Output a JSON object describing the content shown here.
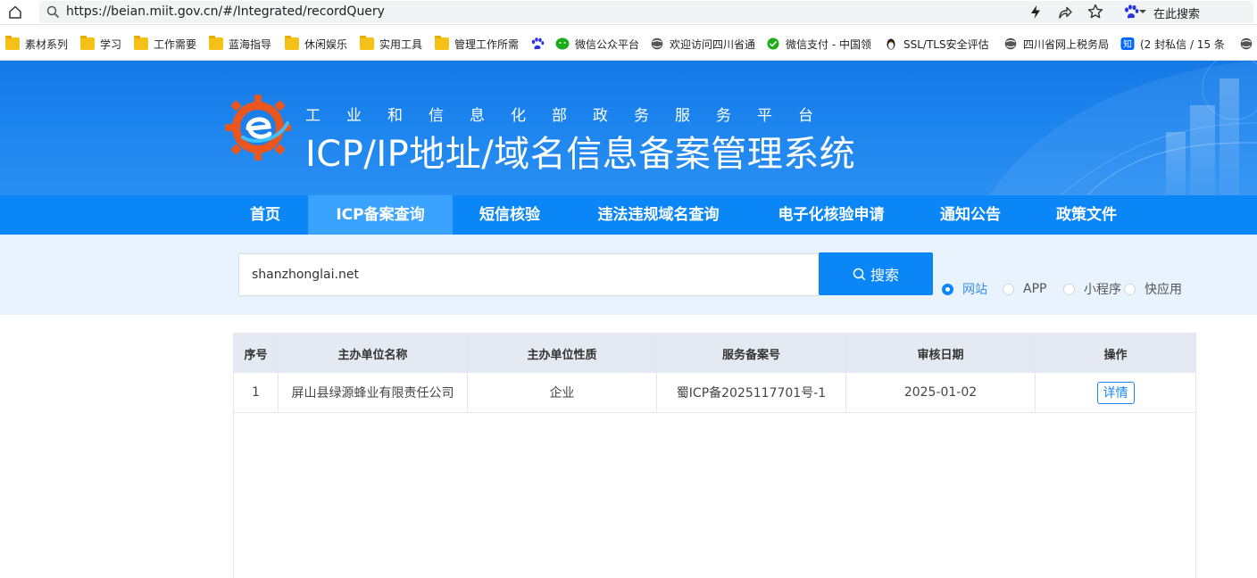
{
  "browser": {
    "url": "https://beian.miit.gov.cn/#/Integrated/recordQuery",
    "search_label": "在此搜索",
    "bookmarks": [
      {
        "label": "素材系列",
        "icon": "folder-icon"
      },
      {
        "label": "学习",
        "icon": "folder-icon"
      },
      {
        "label": "工作需要",
        "icon": "folder-icon"
      },
      {
        "label": "蓝海指导",
        "icon": "folder-icon"
      },
      {
        "label": "休闲娱乐",
        "icon": "folder-icon"
      },
      {
        "label": "实用工具",
        "icon": "folder-icon"
      },
      {
        "label": "管理工作所需",
        "icon": "folder-icon"
      },
      {
        "label": "",
        "icon": "baidu-paw-icon"
      },
      {
        "label": "微信公众平台",
        "icon": "wechat-icon"
      },
      {
        "label": "欢迎访问四川省通",
        "icon": "globe-icon"
      },
      {
        "label": "微信支付 - 中国领",
        "icon": "wechat-pay-icon"
      },
      {
        "label": "SSL/TLS安全评估",
        "icon": "penguin-icon"
      },
      {
        "label": "四川省网上税务局",
        "icon": "globe-icon"
      },
      {
        "label": "(2 封私信 / 15 条",
        "icon": "zhihu-icon"
      },
      {
        "label": "",
        "icon": "globe-icon"
      }
    ]
  },
  "header": {
    "subtitle": "工业和信息化部政务服务平台",
    "title": "ICP/IP地址/域名信息备案管理系统"
  },
  "nav": {
    "items": [
      "首页",
      "ICP备案查询",
      "短信核验",
      "违法违规域名查询",
      "电子化核验申请",
      "通知公告",
      "政策文件"
    ],
    "active": "ICP备案查询"
  },
  "search": {
    "value": "shanzhonglai.net",
    "button_label": "搜索",
    "options": [
      "网站",
      "APP",
      "小程序",
      "快应用"
    ],
    "selected": "网站"
  },
  "table": {
    "headers": [
      "序号",
      "主办单位名称",
      "主办单位性质",
      "服务备案号",
      "审核日期",
      "操作"
    ],
    "rows": [
      {
        "index": "1",
        "org_name": "屏山县绿源蜂业有限责任公司",
        "org_type": "企业",
        "record_no": "蜀ICP备2025117701号-1",
        "date": "2025-01-02",
        "action": "详情"
      }
    ]
  },
  "colors": {
    "primary": "#0a86f6",
    "nav_active": "#3aa2ff",
    "banner": "#1c84ee",
    "search_band": "#e8f3fd"
  }
}
